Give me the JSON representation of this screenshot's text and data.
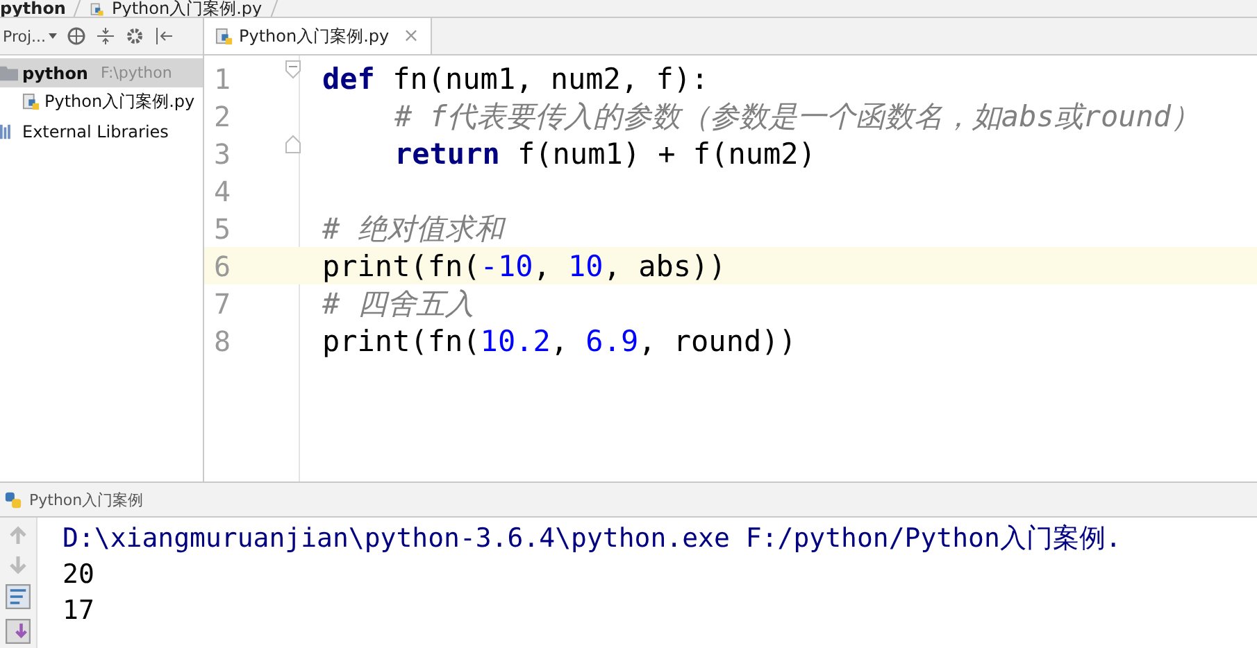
{
  "breadcrumb": [
    {
      "label": "python"
    },
    {
      "label": "Python入门案例.py"
    }
  ],
  "project_panel": {
    "title": "Proj...",
    "tree": [
      {
        "label": "python",
        "path": "F:\\python",
        "kind": "folder",
        "selected": true,
        "children": [
          {
            "label": "Python入门案例.py",
            "kind": "pyfile",
            "selected": false
          }
        ]
      },
      {
        "label": "External Libraries",
        "kind": "library",
        "selected": false
      }
    ]
  },
  "editor": {
    "tabs": [
      {
        "label": "Python入门案例.py",
        "close": "×",
        "selected": true
      }
    ],
    "lines": [
      {
        "number": "1",
        "current": false,
        "fold_start": true,
        "tokens": [
          {
            "kind": "keyword",
            "text": "def"
          },
          {
            "kind": "plain",
            "text": " fn(num1, num2, f):"
          }
        ]
      },
      {
        "number": "2",
        "current": false,
        "indent": true,
        "tokens": [
          {
            "kind": "comment",
            "text": "# f代表要传入的参数（参数是一个函数名，如abs或round）"
          }
        ]
      },
      {
        "number": "3",
        "current": false,
        "fold_end": true,
        "indent": true,
        "tokens": [
          {
            "kind": "keyword",
            "text": "return"
          },
          {
            "kind": "plain",
            "text": " f(num1) + f(num2)"
          }
        ]
      },
      {
        "number": "4",
        "current": false
      },
      {
        "number": "5",
        "current": false,
        "tokens": [
          {
            "kind": "comment",
            "text": "# 绝对值求和"
          }
        ]
      },
      {
        "number": "6",
        "current": true,
        "tokens": [
          {
            "kind": "plain",
            "text": "print(fn("
          },
          {
            "kind": "number",
            "text": "-10"
          },
          {
            "kind": "plain",
            "text": ", "
          },
          {
            "kind": "number",
            "text": "10"
          },
          {
            "kind": "plain",
            "text": ", abs))"
          }
        ]
      },
      {
        "number": "7",
        "current": false,
        "tokens": [
          {
            "kind": "comment",
            "text": "# 四舍五入"
          }
        ]
      },
      {
        "number": "8",
        "current": false,
        "tokens": [
          {
            "kind": "plain",
            "text": "print(fn("
          },
          {
            "kind": "number",
            "text": "10.2"
          },
          {
            "kind": "plain",
            "text": ", "
          },
          {
            "kind": "number",
            "text": "6.9"
          },
          {
            "kind": "plain",
            "text": ", round))"
          }
        ]
      }
    ]
  },
  "run_panel": {
    "title": "Python入门案例",
    "output": [
      {
        "kind": "command",
        "text": "D:\\xiangmuruanjian\\python-3.6.4\\python.exe F:/python/Python入门案例."
      },
      {
        "kind": "result",
        "text": "20"
      },
      {
        "kind": "result",
        "text": "17"
      }
    ]
  }
}
